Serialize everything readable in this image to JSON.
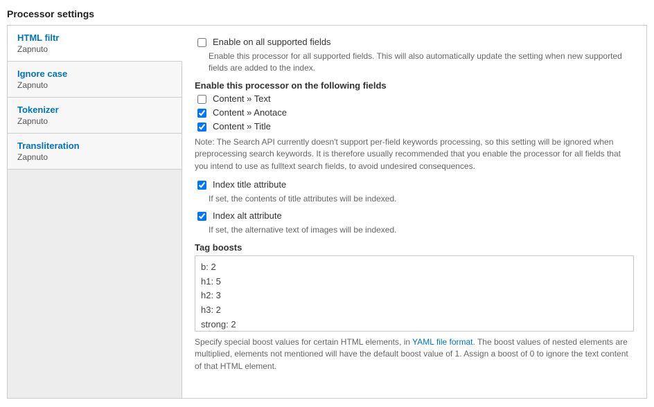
{
  "section_title": "Processor settings",
  "tabs": [
    {
      "title": "HTML filtr",
      "sub": "Zapnuto",
      "active": true
    },
    {
      "title": "Ignore case",
      "sub": "Zapnuto",
      "active": false
    },
    {
      "title": "Tokenizer",
      "sub": "Zapnuto",
      "active": false
    },
    {
      "title": "Transliteration",
      "sub": "Zapnuto",
      "active": false
    }
  ],
  "enable_all": {
    "checked": false,
    "label": "Enable on all supported fields",
    "desc": "Enable this processor for all supported fields. This will also automatically update the setting when new supported fields are added to the index."
  },
  "fields_heading": "Enable this processor on the following fields",
  "fields": [
    {
      "checked": false,
      "label": "Content » Text"
    },
    {
      "checked": true,
      "label": "Content » Anotace"
    },
    {
      "checked": true,
      "label": "Content » Title"
    }
  ],
  "fields_note": "Note: The Search API currently doesn't support per-field keywords processing, so this setting will be ignored when preprocessing search keywords. It is therefore usually recommended that you enable the processor for all fields that you intend to use as fulltext search fields, to avoid undesired consequences.",
  "index_title": {
    "checked": true,
    "label": "Index title attribute",
    "desc": "If set, the contents of title attributes will be indexed."
  },
  "index_alt": {
    "checked": true,
    "label": "Index alt attribute",
    "desc": "If set, the alternative text of images will be indexed."
  },
  "tag_boosts": {
    "heading": "Tag boosts",
    "value": "b: 2\nh1: 5\nh2: 3\nh3: 2\nstrong: 2",
    "desc_pre": "Specify special boost values for certain HTML elements, in ",
    "desc_link": "YAML file format",
    "desc_post": ". The boost values of nested elements are multiplied, elements not mentioned will have the default boost value of 1. Assign a boost of 0 to ignore the text content of that HTML element."
  }
}
